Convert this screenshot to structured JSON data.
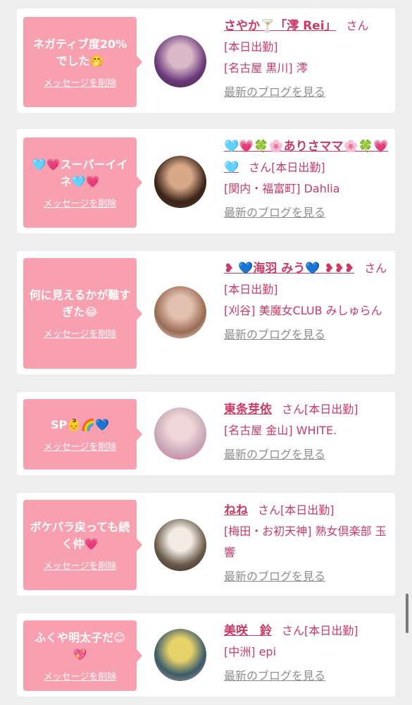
{
  "cards": [
    {
      "message": "ネガティブ度20%でした🤭",
      "delete_label": "メッセージを削除",
      "name": "さやか🍸「澪 Rei」",
      "honorific": "さん",
      "status": "[本日出勤]",
      "shop": "[名古屋 黒川] 澪",
      "blog_label": "最新のブログを見る",
      "avatar_colors": [
        "#6b3a7a",
        "#d9b8c8",
        "#3a2240"
      ]
    },
    {
      "message": "🩵💗スーパーイイネ🩵💗",
      "delete_label": "メッセージを削除",
      "name": "🩵💗🍀🌸ありさママ🌸🍀💗🩵",
      "honorific": "さん",
      "status": "[本日出勤]",
      "shop": "[関内・福富町] Dahlia",
      "blog_label": "最新のブログを見る",
      "avatar_colors": [
        "#3a2418",
        "#d8a888",
        "#5a3a28"
      ]
    },
    {
      "message": "何に見えるかが難すぎた😂",
      "delete_label": "メッセージを削除",
      "name": "❥ 💙海羽 みう💙 ❥❥❥",
      "honorific": "さん",
      "status": "[本日出勤]",
      "shop": "[刈谷] 美魔女CLUB みしゅらん",
      "blog_label": "最新のブログを見る",
      "avatar_colors": [
        "#9a6a52",
        "#e2c1b0",
        "#f4ece8"
      ]
    },
    {
      "message": "SP👶🌈💙",
      "delete_label": "メッセージを削除",
      "name": "東条芽依",
      "honorific": "さん",
      "status": "[本日出勤]",
      "shop": "[名古屋 金山] WHITE.",
      "blog_label": "最新のブログを見る",
      "avatar_colors": [
        "#c8a8b8",
        "#f0d8d8",
        "#e85a9a"
      ]
    },
    {
      "message": "ボケパラ戻っても続く仲💗",
      "delete_label": "メッセージを削除",
      "name": "ねね",
      "honorific": "さん",
      "status": "[本日出勤]",
      "shop": "[梅田・お初天神] 熟女倶楽部 玉響",
      "blog_label": "最新のブログを見る",
      "avatar_colors": [
        "#6a5a4a",
        "#f2ece4",
        "#2a2220"
      ]
    },
    {
      "message": "ふくや明太子だ😊💖",
      "delete_label": "メッセージを削除",
      "name": "美咲　鈴",
      "honorific": "さん",
      "status": "[本日出勤]",
      "shop": "[中洲] epi",
      "blog_label": "最新のブログを見る",
      "avatar_colors": [
        "#3a5a6a",
        "#e8d26a",
        "#c8a890"
      ]
    }
  ]
}
